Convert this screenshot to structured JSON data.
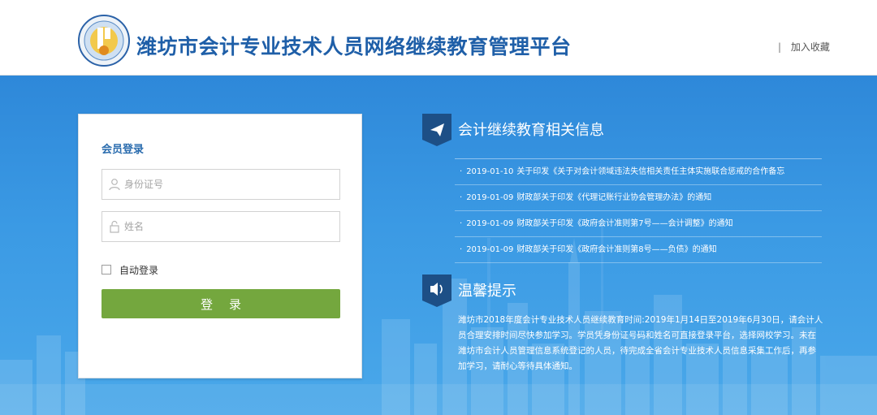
{
  "header": {
    "title": "潍坊市会计专业技术人员网络继续教育管理平台",
    "favorite_sep": "|",
    "favorite_label": "加入收藏",
    "logo_icon": "accounting-association-seal-icon"
  },
  "login": {
    "title": "会员登录",
    "id_placeholder": "身份证号",
    "name_placeholder": "姓名",
    "auto_login_label": "自动登录",
    "submit_label": "登录",
    "accent_color": "#74a73e"
  },
  "news": {
    "title": "会计继续教育相关信息",
    "icon": "paper-plane-icon",
    "items": [
      {
        "bullet": "·",
        "date": "2019-01-10",
        "text": "关于印发《关于对会计领域违法失信相关责任主体实施联合惩戒的合作备忘"
      },
      {
        "bullet": "·",
        "date": "2019-01-09",
        "text": "财政部关于印发《代理记账行业协会管理办法》的通知"
      },
      {
        "bullet": "·",
        "date": "2019-01-09",
        "text": "财政部关于印发《政府会计准则第7号——会计调整》的通知"
      },
      {
        "bullet": "·",
        "date": "2019-01-09",
        "text": "财政部关于印发《政府会计准则第8号——负债》的通知"
      }
    ]
  },
  "tips": {
    "title": "温馨提示",
    "icon": "speaker-icon",
    "text": "潍坊市2018年度会计专业技术人员继续教育时间:2019年1月14日至2019年6月30日，请会计人员合理安排时间尽快参加学习。学员凭身份证号码和姓名可直接登录平台，选择网校学习。未在潍坊市会计人员管理信息系统登记的人员，待完成全省会计专业技术人员信息采集工作后，再参加学习，请耐心等待具体通知。"
  },
  "colors": {
    "banner_top": "#2e88d9",
    "banner_bottom": "#4aa8ea",
    "title_blue": "#1f5fa8"
  }
}
